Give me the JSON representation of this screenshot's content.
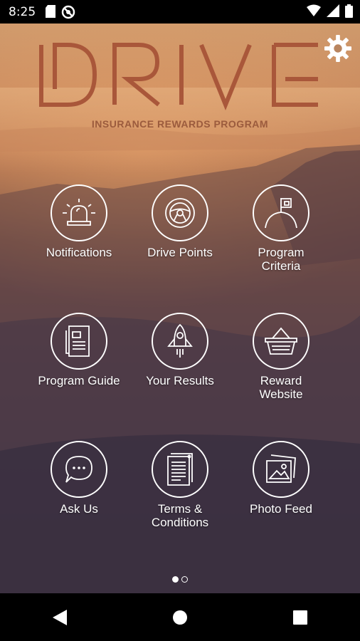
{
  "status_bar": {
    "time": "8:25",
    "left_icons": [
      "sd-card-icon",
      "no-sync-icon"
    ],
    "right_icons": [
      "wifi-icon",
      "signal-icon",
      "battery-icon"
    ]
  },
  "header": {
    "logo_text": "DRIVE",
    "tagline": "INSURANCE REWARDS PROGRAM",
    "settings_icon": "gear-icon"
  },
  "menu": {
    "items": [
      {
        "label": "Notifications",
        "icon": "siren-icon"
      },
      {
        "label": "Drive Points",
        "icon": "steering-wheel-icon"
      },
      {
        "label": "Program Criteria",
        "icon": "summit-flag-icon"
      },
      {
        "label": "Program Guide",
        "icon": "guide-book-icon"
      },
      {
        "label": "Your Results",
        "icon": "rocket-icon"
      },
      {
        "label": "Reward Website",
        "icon": "basket-icon"
      },
      {
        "label": "Ask Us",
        "icon": "chat-bubble-icon"
      },
      {
        "label": "Terms & Conditions",
        "icon": "document-icon"
      },
      {
        "label": "Photo Feed",
        "icon": "photos-icon"
      }
    ]
  },
  "pager": {
    "current_page": 1,
    "total_pages": 2
  },
  "nav_bar": {
    "buttons": [
      "back-icon",
      "home-icon",
      "recents-icon"
    ]
  },
  "colors": {
    "logo": "#a9573a",
    "tagline": "#9b5b3d",
    "accent_white": "#ffffff"
  }
}
